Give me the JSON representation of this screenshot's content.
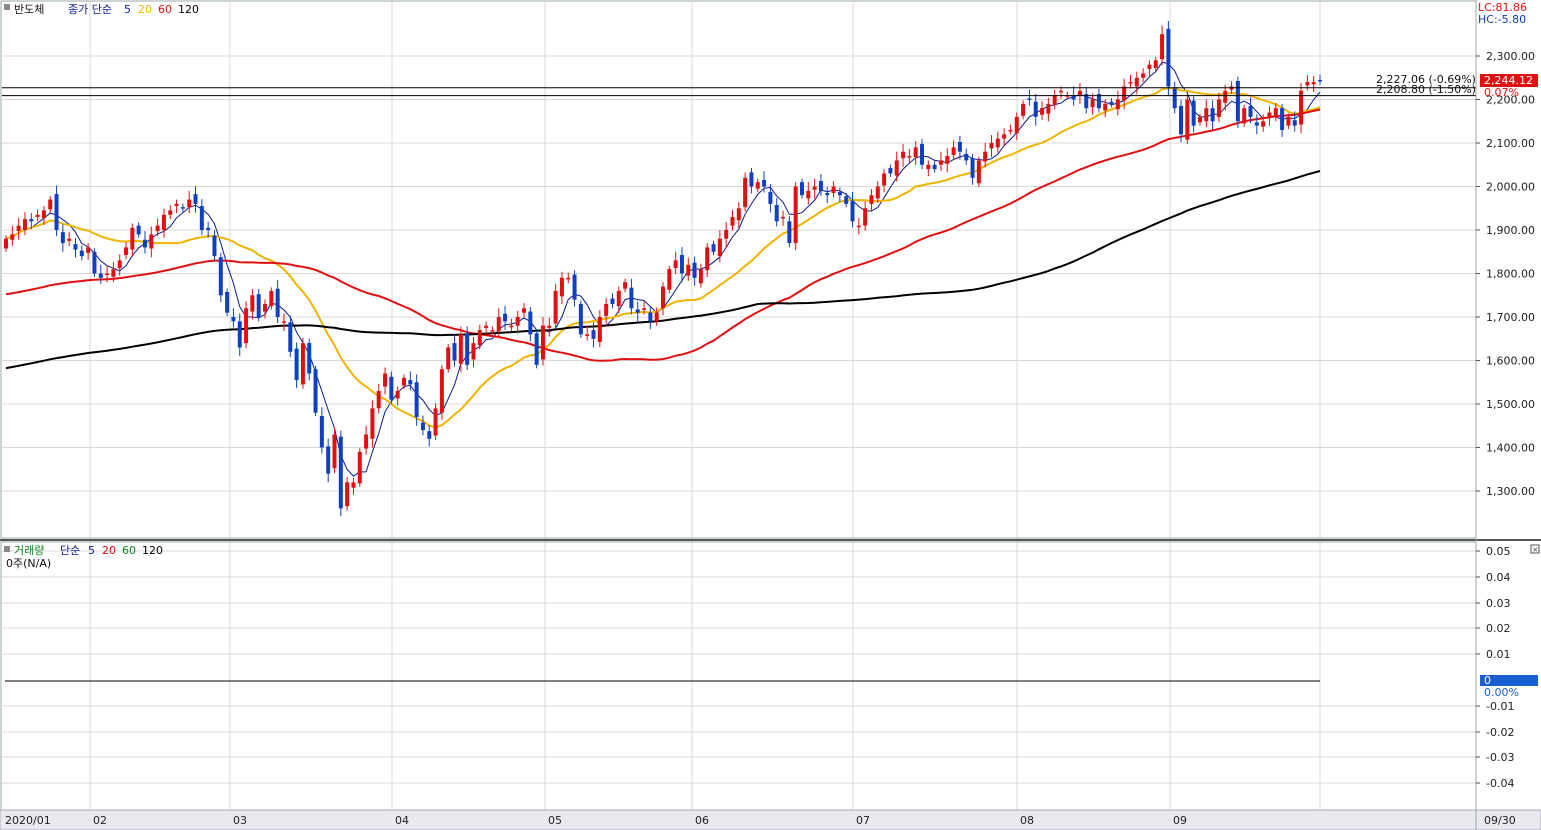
{
  "price_panel": {
    "name": "반도체",
    "ma_label": "종가 단순",
    "ma_periods": [
      "5",
      "20",
      "60",
      "120"
    ],
    "ma_colors": [
      "#0a1a8c",
      "#f0b400",
      "#e01010",
      "#000000"
    ],
    "lc_label": "LC:81.86",
    "hc_label": "HC:-5.80",
    "current_value": "2,244.12",
    "pct_label": "0.07%",
    "hline1_label": "2,227.06 (-0.69%)",
    "hline2_label": "2,208.80 (-1.50%)",
    "y_ticks": [
      "2,300.00",
      "2,200.00",
      "2,100.00",
      "2,000.00",
      "1,900.00",
      "1,800.00",
      "1,700.00",
      "1,600.00",
      "1,500.00",
      "1,400.00",
      "1,300.00"
    ]
  },
  "volume_panel": {
    "name": "거래량",
    "ma_label": "단순",
    "ma_periods": [
      "5",
      "20",
      "60",
      "120"
    ],
    "ma_colors": [
      "#0a1a8c",
      "#e01010",
      "#0a8a20",
      "#000000"
    ],
    "value_label": "0주(N/A)",
    "current_value": "0",
    "pct_label": "0.00%",
    "y_ticks": [
      "0.05",
      "0.04",
      "0.03",
      "0.02",
      "0.01",
      "-0.01",
      "-0.02",
      "-0.03",
      "-0.04"
    ]
  },
  "x_axis": {
    "labels": [
      "2020/01",
      "02",
      "03",
      "04",
      "05",
      "06",
      "07",
      "08",
      "09"
    ],
    "end_label": "09/30"
  },
  "colors": {
    "up": "#e01010",
    "down": "#1040c0",
    "grid": "#d8d8d8",
    "current_bg": "#e01010",
    "volume_current_bg": "#1a5fd0"
  },
  "chart_data": {
    "type": "candlestick",
    "title": "반도체",
    "x_range": [
      "2020/01",
      "09/30"
    ],
    "y_range": [
      1230,
      2380
    ],
    "reference_lines": [
      2227.06,
      2208.8
    ],
    "close": [
      1880,
      1890,
      1910,
      1925,
      1920,
      1935,
      1945,
      1970,
      1900,
      1870,
      1880,
      1855,
      1840,
      1860,
      1800,
      1790,
      1800,
      1810,
      1830,
      1860,
      1905,
      1890,
      1860,
      1890,
      1910,
      1935,
      1945,
      1960,
      1950,
      1970,
      1960,
      1900,
      1900,
      1840,
      1750,
      1710,
      1690,
      1630,
      1720,
      1750,
      1700,
      1730,
      1760,
      1700,
      1690,
      1620,
      1555,
      1640,
      1570,
      1480,
      1400,
      1340,
      1430,
      1260,
      1320,
      1320,
      1390,
      1430,
      1490,
      1530,
      1570,
      1510,
      1530,
      1560,
      1545,
      1470,
      1440,
      1420,
      1490,
      1580,
      1630,
      1600,
      1660,
      1590,
      1640,
      1670,
      1680,
      1670,
      1700,
      1690,
      1680,
      1700,
      1720,
      1660,
      1590,
      1680,
      1680,
      1760,
      1790,
      1790,
      1740,
      1660,
      1660,
      1650,
      1700,
      1730,
      1730,
      1760,
      1780,
      1720,
      1710,
      1720,
      1690,
      1710,
      1770,
      1810,
      1830,
      1800,
      1820,
      1790,
      1810,
      1860,
      1850,
      1880,
      1900,
      1930,
      1950,
      2020,
      2000,
      2010,
      2000,
      1960,
      1920,
      1930,
      1870,
      2000,
      1980,
      1990,
      2000,
      1990,
      1980,
      2000,
      1980,
      1960,
      1920,
      1910,
      1950,
      1980,
      2000,
      2030,
      2030,
      2060,
      2080,
      2070,
      2090,
      2050,
      2050,
      2040,
      2060,
      2070,
      2090,
      2080,
      2060,
      2020,
      2060,
      2080,
      2100,
      2110,
      2120,
      2130,
      2160,
      2190,
      2200,
      2160,
      2180,
      2190,
      2210,
      2220,
      2210,
      2200,
      2220,
      2180,
      2200,
      2180,
      2190,
      2190,
      2200,
      2230,
      2240,
      2250,
      2260,
      2280,
      2290,
      2350,
      2230,
      2180,
      2120,
      2200,
      2140,
      2160,
      2180,
      2150,
      2200,
      2220,
      2230,
      2150,
      2180,
      2160,
      2140,
      2150,
      2170,
      2180,
      2130,
      2160,
      2140,
      2220,
      2240,
      2240,
      2244
    ],
    "series": [
      {
        "name": "5"
      },
      {
        "name": "20"
      },
      {
        "name": "60"
      },
      {
        "name": "120"
      }
    ]
  }
}
